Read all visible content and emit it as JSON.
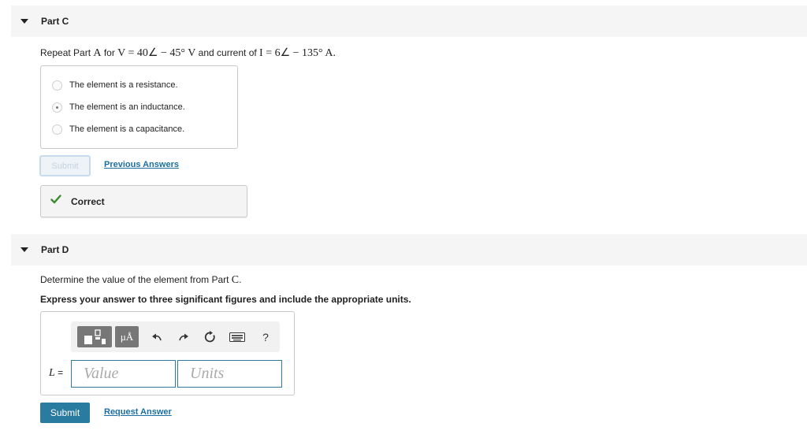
{
  "partC": {
    "title": "Part C",
    "prompt": {
      "pre": "Repeat Part ",
      "partRef": "A",
      "for": " for ",
      "eqV": "V = 40∠ − 45° V",
      "mid": " and current of ",
      "eqI": "I = 6∠ − 135° A."
    },
    "choices": [
      {
        "label": "The element is a resistance.",
        "selected": false
      },
      {
        "label": "The element is an inductance.",
        "selected": true
      },
      {
        "label": "The element is a capacitance.",
        "selected": false
      }
    ],
    "submit_label": "Submit",
    "previous_answers_label": "Previous Answers",
    "feedback": "Correct",
    "feedback_color": "#3a8a2e"
  },
  "partD": {
    "title": "Part D",
    "prompt": {
      "pre": "Determine the value of the element from Part ",
      "partRef": "C",
      "post": "."
    },
    "instruction": "Express your answer to three significant figures and include the appropriate units.",
    "toolbar": {
      "units_label": "μÅ",
      "help_label": "?"
    },
    "variable": "L",
    "equals": "=",
    "value_placeholder": "Value",
    "units_placeholder": "Units",
    "submit_label": "Submit",
    "request_answer_label": "Request Answer"
  },
  "colors": {
    "accent": "#2a7ba0",
    "link": "#1c6fa0",
    "header_bg": "#f5f5f5"
  }
}
